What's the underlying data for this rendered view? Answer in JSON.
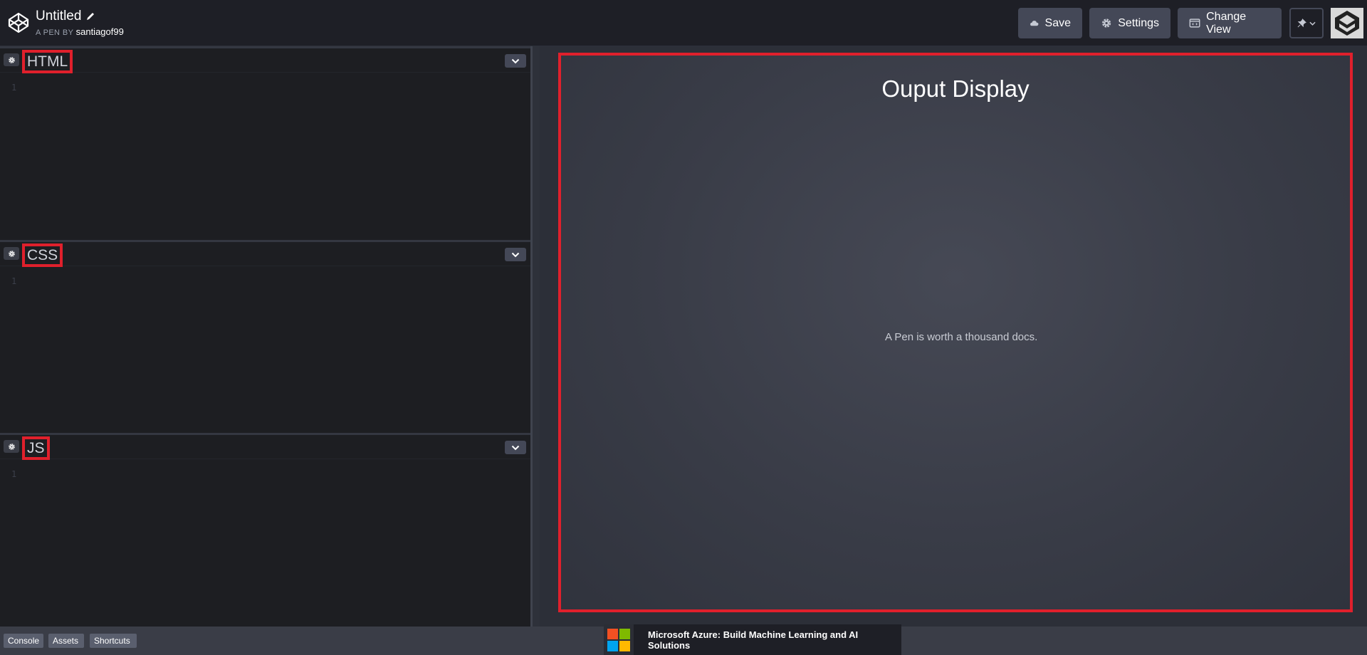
{
  "header": {
    "pen_title": "Untitled",
    "byline_prefix": "A PEN BY",
    "username": "santiagof99",
    "buttons": {
      "save": "Save",
      "settings": "Settings",
      "change_view": "Change View"
    }
  },
  "editors": [
    {
      "label": "HTML",
      "line_number": "1"
    },
    {
      "label": "CSS",
      "line_number": "1"
    },
    {
      "label": "JS",
      "line_number": "1"
    }
  ],
  "output": {
    "title": "Ouput Display",
    "text": "A Pen is worth a thousand docs."
  },
  "footer": {
    "buttons": [
      "Console",
      "Assets",
      "Shortcuts"
    ],
    "ad_text": "Microsoft Azure: Build Machine Learning and AI Solutions"
  },
  "colors": {
    "highlight": "#e0202c",
    "header_bg": "#1e1f26",
    "button_bg": "#444857",
    "ms_red": "#f25022",
    "ms_green": "#7fba00",
    "ms_blue": "#00a4ef",
    "ms_yellow": "#ffb900"
  }
}
